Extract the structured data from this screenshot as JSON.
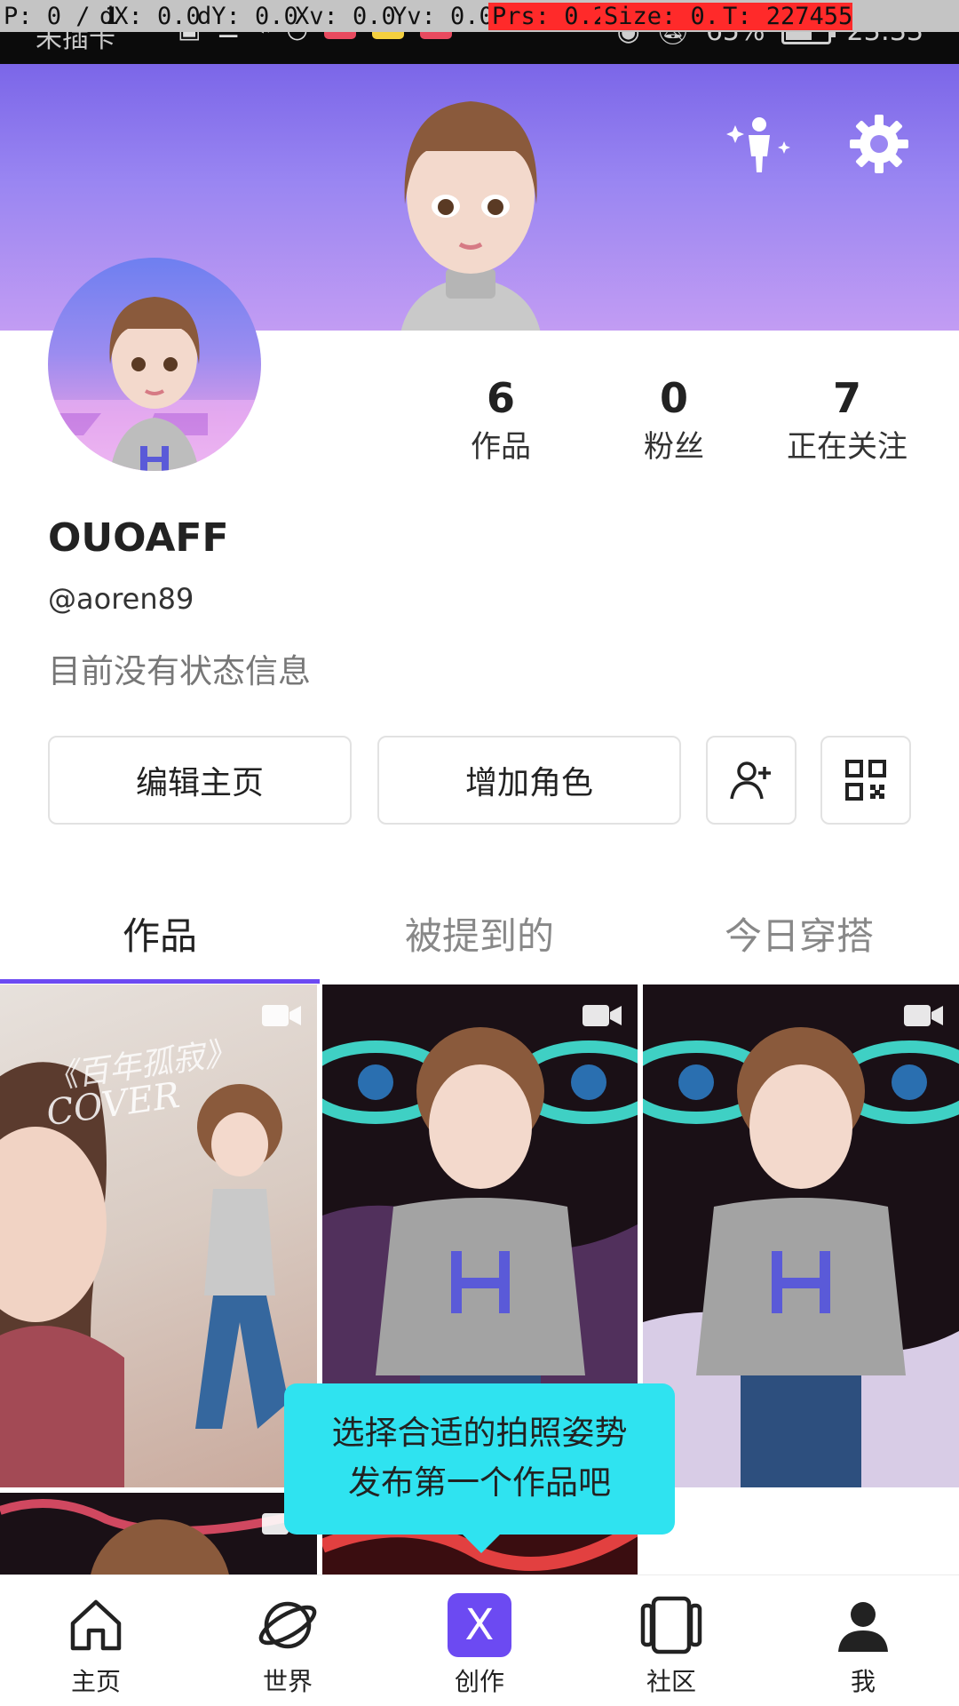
{
  "debug": {
    "p": "P: 0 / 1",
    "dx": "dX: 0.0",
    "dy": "dY: 0.0",
    "xv": "Xv: 0.0",
    "yv": "Yv: 0.0",
    "prs": "Prs: 0.20",
    "size": "Size: 0.40",
    "t": "T: 227455"
  },
  "status_bar": {
    "carrier": "未插卡",
    "battery": "65%",
    "battery_level": 0.65,
    "time": "23:33"
  },
  "header": {
    "sparkle_icon": "avatar-sparkle-icon",
    "settings_icon": "gear-icon"
  },
  "profile": {
    "display_name": "OUOAFF",
    "handle": "@aoren89",
    "status": "目前没有状态信息",
    "stats": [
      {
        "value": "6",
        "label": "作品"
      },
      {
        "value": "0",
        "label": "粉丝"
      },
      {
        "value": "7",
        "label": "正在关注"
      }
    ]
  },
  "actions": {
    "edit_label": "编辑主页",
    "add_character_label": "增加角色"
  },
  "tabs": [
    {
      "label": "作品",
      "active": true
    },
    {
      "label": "被提到的",
      "active": false
    },
    {
      "label": "今日穿搭",
      "active": false
    }
  ],
  "grid": {
    "cover_text_1": "《百年孤寂》",
    "cover_text_2": "COVER"
  },
  "tooltip": {
    "line1": "选择合适的拍照姿势",
    "line2": "发布第一个作品吧"
  },
  "bottom_nav": [
    {
      "label": "主页",
      "icon": "home-icon"
    },
    {
      "label": "世界",
      "icon": "planet-icon"
    },
    {
      "label": "创作",
      "icon": "create-icon",
      "glyph": "X"
    },
    {
      "label": "社区",
      "icon": "community-icon"
    },
    {
      "label": "我",
      "icon": "person-icon"
    }
  ],
  "colors": {
    "accent": "#6c4af2",
    "tooltip": "#2fe3f0",
    "banner_top": "#7b66e8",
    "banner_bottom": "#c29cf3"
  }
}
